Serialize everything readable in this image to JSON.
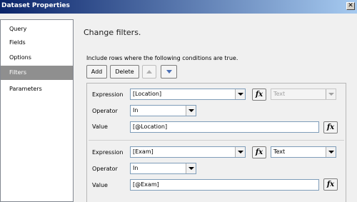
{
  "window": {
    "title": "Dataset Properties",
    "close_glyph": "✕"
  },
  "sidebar": {
    "items": [
      {
        "label": "Query"
      },
      {
        "label": "Fields"
      },
      {
        "label": "Options"
      },
      {
        "label": "Filters",
        "selected": true
      },
      {
        "label": "Parameters"
      }
    ]
  },
  "main": {
    "heading": "Change filters.",
    "instruction": "Include rows where the following conditions are true.",
    "toolbar": {
      "add_label": "Add",
      "delete_label": "Delete",
      "move_up_icon": "arrow-up-icon",
      "move_down_icon": "arrow-down-icon"
    },
    "labels": {
      "expression": "Expression",
      "operator": "Operator",
      "value": "Value"
    },
    "fx_glyph": "fx",
    "filters": [
      {
        "expression": "[Location]",
        "type": "Text",
        "type_disabled": true,
        "operator": "In",
        "value": "[@Location]"
      },
      {
        "expression": "[Exam]",
        "type": "Text",
        "type_disabled": false,
        "operator": "In",
        "value": "[@Exam]"
      }
    ]
  }
}
